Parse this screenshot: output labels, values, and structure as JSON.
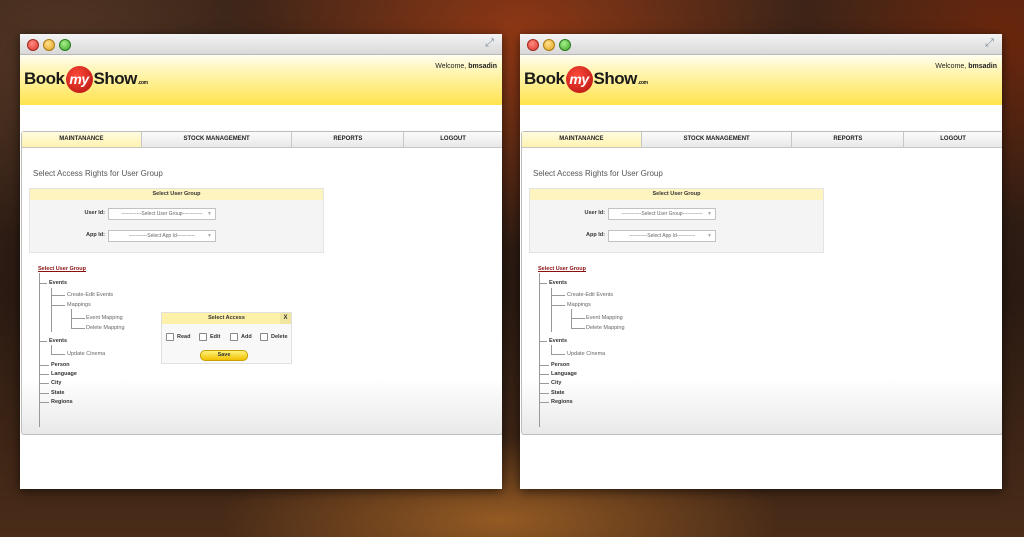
{
  "windows": {
    "left": {
      "header": {
        "brand_prefix": "Book",
        "brand_my": "my",
        "brand_suffix": "Show",
        "brand_com": ".com",
        "welcome": "Welcome,",
        "username": "bmsadin"
      },
      "tabs": [
        "MAINTANANCE",
        "STOCK MANAGEMENT",
        "REPORTS",
        "LOGOUT"
      ],
      "page_title": "Select Access Rights for User Group",
      "form": {
        "header": "Select User Group",
        "user_label": "User Id:",
        "user_select": "------------Select User Group------------",
        "app_label": "App Id:",
        "app_select": "-----------Select App Id-----------"
      },
      "tree": {
        "root": "Select User Group",
        "events1": "Events",
        "create_edit": "Create-Edit Events",
        "mappings": "Mappings",
        "event_mapping": "Event Mapping",
        "delete_mapping": "Delete Mapping",
        "events2": "Events",
        "update_cinema": "Update Cinema",
        "person": "Person",
        "language": "Language",
        "city": "City",
        "state": "State",
        "regions": "Regions"
      },
      "popup": {
        "title": "Select Access",
        "close": "X",
        "read": "Read",
        "edit": "Edit",
        "add": "Add",
        "delete": "Delete",
        "save": "Save"
      }
    },
    "right": {
      "header": {
        "brand_prefix": "Book",
        "brand_my": "my",
        "brand_suffix": "Show",
        "brand_com": ".com",
        "welcome": "Welcome,",
        "username": "bmsadin"
      },
      "tabs": [
        "MAINTANANCE",
        "STOCK MANAGEMENT",
        "REPORTS",
        "LOGOUT"
      ],
      "page_title": "Select Access Rights for User Group",
      "form": {
        "header": "Select User Group",
        "user_label": "User Id:",
        "user_select": "------------Select User Group------------",
        "app_label": "App Id:",
        "app_select": "-----------Select App Id-----------"
      },
      "tree": {
        "root": "Select User Group",
        "events1": "Events",
        "create_edit": "Create-Edit Events",
        "mappings": "Mappings",
        "event_mapping": "Event Mapping",
        "delete_mapping": "Delete Mapping",
        "events2": "Events",
        "update_cinema": "Update Cinema",
        "person": "Person",
        "language": "Language",
        "city": "City",
        "state": "State",
        "regions": "Regions"
      }
    }
  },
  "icons": {
    "resize": "expand-arrows-icon",
    "dropdown": "chevron-down-icon"
  },
  "colors": {
    "header_yellow": "#ffe34d",
    "brand_red": "#c41a12",
    "tree_root": "#8a1010",
    "save_button": "#f2c000"
  }
}
